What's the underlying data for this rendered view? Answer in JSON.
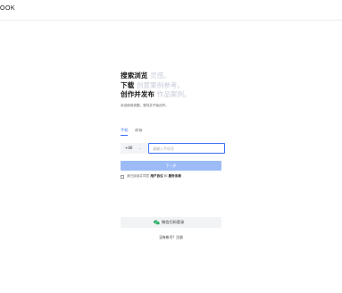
{
  "header": {
    "brand": "OOK"
  },
  "hero": {
    "line1_strong": "搜索浏览",
    "line1_light": "灵感。",
    "line2_strong": "下载",
    "line2_light": "创意案例参考。",
    "line3_strong": "创作并发布",
    "line3_light": "作品案例。",
    "subtitle": "欢迎使用我酷，登陆并开始创作。"
  },
  "tabs": [
    {
      "label": "手机",
      "active": true
    },
    {
      "label": "邮箱",
      "active": false
    }
  ],
  "phone": {
    "country_code": "+86",
    "dropdown_glyph": "⌄",
    "placeholder": "请输入手机号",
    "value": ""
  },
  "next_button": {
    "label": "下一步"
  },
  "agreement": {
    "prefix": "我已阅读并同意",
    "link1": "用户协议",
    "conjunction": "和",
    "link2": "服务条款"
  },
  "wechat_login": {
    "label": "微信扫码登录",
    "icon": "wechat-icon"
  },
  "no_account": {
    "label": "没有帐号？注册"
  },
  "colors": {
    "accent": "#3b6ef5",
    "button_disabled": "#9dbcf7",
    "headline_light": "#c7ccd8",
    "wechat_green": "#2aae67"
  }
}
